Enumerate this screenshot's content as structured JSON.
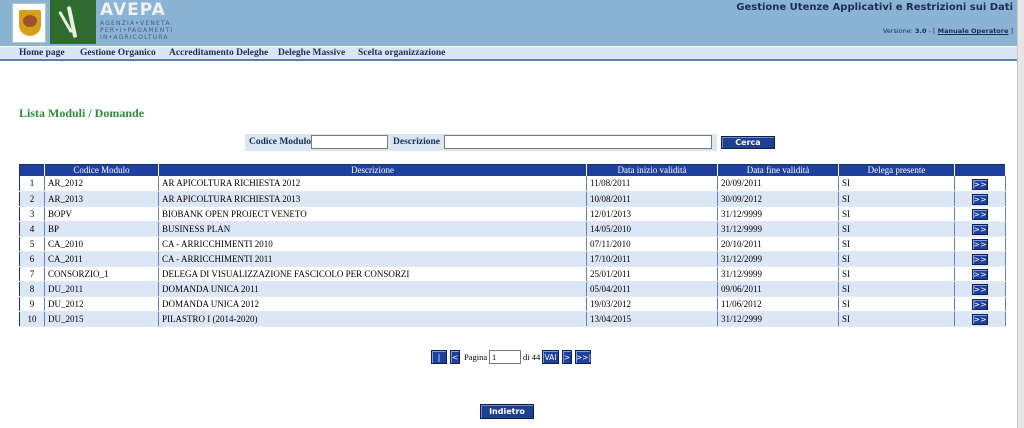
{
  "header": {
    "logo_text": "AVEPA",
    "logo_sub_1": "AGENZIA•VENETA",
    "logo_sub_2": "PER•I•PAGAMENTI",
    "logo_sub_3": "IN•AGRICOLTURA",
    "app_title": "Gestione Utenze Applicativi e Restrizioni sui Dati",
    "version_label": "Versione:",
    "version_value": "3.0",
    "version_sep": " - [ ",
    "manual_link": "Manuale Operatore",
    "manual_close": " ]"
  },
  "menu": {
    "items": [
      "Home page",
      "Gestione Organico",
      "Accreditamento Deleghe",
      "Deleghe Massive",
      "Scelta organizzazione"
    ]
  },
  "page": {
    "title": "Lista Moduli / Domande"
  },
  "search": {
    "code_label": "Codice Modulo",
    "code_value": "",
    "desc_label": "Descrizione",
    "desc_value": "",
    "button_label": "Cerca"
  },
  "table": {
    "headers": [
      "",
      "Codice Modulo",
      "Descrizione",
      "Data inizio validità",
      "Data fine validità",
      "Delega presente",
      ""
    ],
    "rows": [
      {
        "n": "1",
        "code": "AR_2012",
        "desc": "AR APICOLTURA RICHIESTA 2012",
        "start": "11/08/2011",
        "end": "20/09/2011",
        "delega": "SI",
        "action": ">>"
      },
      {
        "n": "2",
        "code": "AR_2013",
        "desc": "AR APICOLTURA RICHIESTA 2013",
        "start": "10/08/2011",
        "end": "30/09/2012",
        "delega": "SI",
        "action": ">>"
      },
      {
        "n": "3",
        "code": "BOPV",
        "desc": "BIOBANK OPEN PROJECT VENETO",
        "start": "12/01/2013",
        "end": "31/12/9999",
        "delega": "SI",
        "action": ">>"
      },
      {
        "n": "4",
        "code": "BP",
        "desc": "BUSINESS PLAN",
        "start": "14/05/2010",
        "end": "31/12/9999",
        "delega": "SI",
        "action": ">>"
      },
      {
        "n": "5",
        "code": "CA_2010",
        "desc": "CA - ARRICCHIMENTI 2010",
        "start": "07/11/2010",
        "end": "20/10/2011",
        "delega": "SI",
        "action": ">>"
      },
      {
        "n": "6",
        "code": "CA_2011",
        "desc": "CA - ARRICCHIMENTI 2011",
        "start": "17/10/2011",
        "end": "31/12/2099",
        "delega": "SI",
        "action": ">>"
      },
      {
        "n": "7",
        "code": "CONSORZIO_1",
        "desc": "DELEGA DI VISUALIZZAZIONE FASCICOLO PER CONSORZI",
        "start": "25/01/2011",
        "end": "31/12/9999",
        "delega": "SI",
        "action": ">>"
      },
      {
        "n": "8",
        "code": "DU_2011",
        "desc": "DOMANDA UNICA 2011",
        "start": "05/04/2011",
        "end": "09/06/2011",
        "delega": "SI",
        "action": ">>"
      },
      {
        "n": "9",
        "code": "DU_2012",
        "desc": "DOMANDA UNICA 2012",
        "start": "19/03/2012",
        "end": "11/06/2012",
        "delega": "SI",
        "action": ">>"
      },
      {
        "n": "10",
        "code": "DU_2015",
        "desc": "PILASTRO I (2014-2020)",
        "start": "13/04/2015",
        "end": "31/12/2999",
        "delega": "SI",
        "action": ">>"
      }
    ]
  },
  "pager": {
    "first": "|<<",
    "prev": "<",
    "page_label": "Pagina",
    "page_value": "1",
    "of_label": "di 44",
    "go": "VAI",
    "next": ">",
    "last": ">>|"
  },
  "footer": {
    "back_button": "Indietro"
  },
  "colors": {
    "header_bg": "#8bb3d4",
    "button_blue": "#1f3f9f",
    "title_green": "#2e8b3a",
    "row_alt": "#dce7f5"
  }
}
